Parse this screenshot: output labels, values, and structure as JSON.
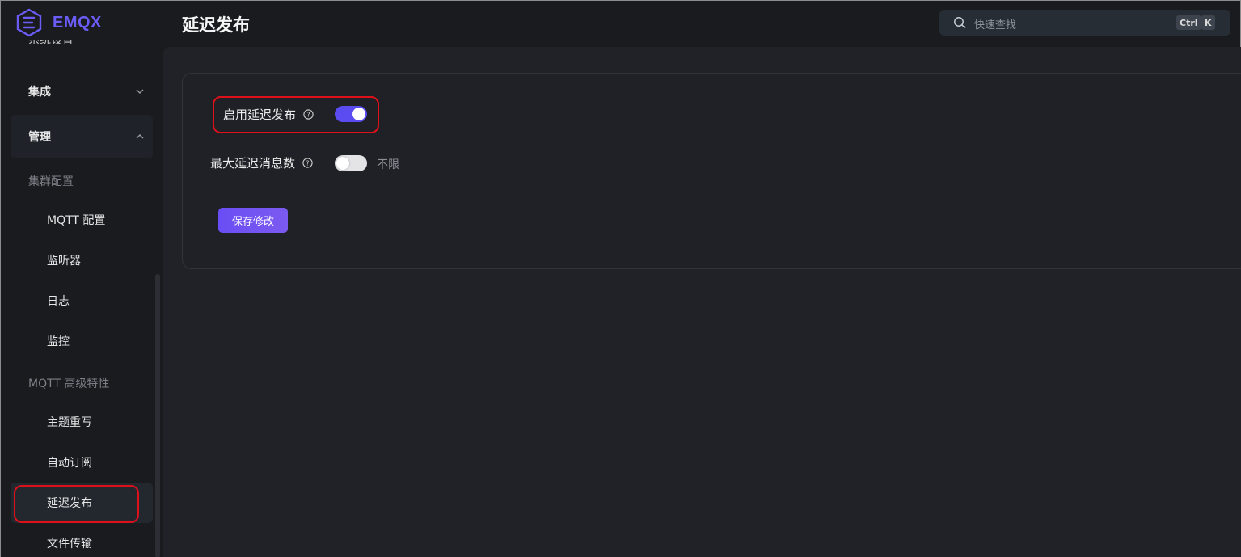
{
  "app": {
    "name": "EMQX",
    "brand_color": "#6b5cf6"
  },
  "sidebar": {
    "partial_item": "系统设置",
    "groups": [
      {
        "label": "集成",
        "expanded": false
      },
      {
        "label": "管理",
        "expanded": true
      }
    ],
    "sections": [
      {
        "label": "集群配置",
        "items": [
          "MQTT 配置",
          "监听器",
          "日志",
          "监控"
        ]
      },
      {
        "label": "MQTT 高级特性",
        "items": [
          "主题重写",
          "自动订阅",
          "延迟发布",
          "文件传输"
        ]
      }
    ],
    "active_item": "延迟发布"
  },
  "header": {
    "title": "延迟发布",
    "search": {
      "placeholder": "快速查找",
      "shortcut_keys": [
        "Ctrl",
        "K"
      ]
    }
  },
  "form": {
    "enable": {
      "label": "启用延迟发布",
      "value": true
    },
    "max_messages": {
      "label": "最大延迟消息数",
      "value": false,
      "value_text": "不限"
    },
    "save_label": "保存修改"
  },
  "colors": {
    "accent": "#5b4cf2",
    "highlight": "#e0101a"
  }
}
